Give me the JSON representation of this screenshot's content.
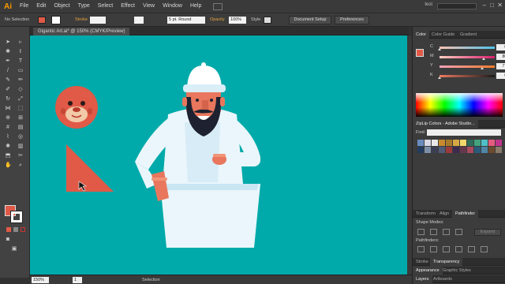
{
  "app": {
    "logo": "Ai"
  },
  "menu": [
    "File",
    "Edit",
    "Object",
    "Type",
    "Select",
    "Effect",
    "View",
    "Window",
    "Help"
  ],
  "workspace": "test",
  "window_controls": {
    "minimize": "–",
    "maximize": "□",
    "close": "✕"
  },
  "control_bar": {
    "selection_label": "No Selection",
    "stroke_label": "Stroke",
    "brush_value": "5 pt. Round",
    "opacity_label": "Opacity",
    "opacity_value": "100%",
    "style_label": "Style",
    "document_setup": "Document Setup",
    "preferences": "Preferences"
  },
  "document": {
    "tab_title": "Gigantic Art.ai* @ 150% (CMYK/Preview)"
  },
  "colors": {
    "fill": "#e05a47",
    "artboard": "#00aaaa",
    "skin": "#e8775d",
    "robe": "#eaf6fb",
    "robe_shadow": "#c9e6f3",
    "beard": "#1e2230",
    "triangle": "#e05a47",
    "circle": "#e05a47"
  },
  "status_bar": {
    "zoom": "150%",
    "page": "1",
    "tool": "Selection"
  },
  "panels": {
    "color": {
      "tabs": [
        "Color",
        "Color Guide",
        "Gradient"
      ],
      "sliders": [
        {
          "label": "C",
          "value": "0",
          "percent": 0,
          "gradient": "linear-gradient(to right,#f9c1b0,#4fc3e8)"
        },
        {
          "label": "M",
          "value": "80",
          "percent": 80,
          "gradient": "linear-gradient(to right,#ffd0c0,#d81f6e)"
        },
        {
          "label": "Y",
          "value": "77",
          "percent": 77,
          "gradient": "linear-gradient(to right,#f1a0b8,#f07a2a)"
        },
        {
          "label": "K",
          "value": "0",
          "percent": 0,
          "gradient": "linear-gradient(to right,#f07a60,#1a1a1a)"
        }
      ]
    },
    "ziplip": {
      "title": "ZipLip Colors - Adobe Studio...",
      "find_label": "Find:",
      "swatches": [
        "#6b8bbf",
        "#d7d7e6",
        "#e8e8e8",
        "#c98a2e",
        "#a87a2b",
        "#d6a845",
        "#f0d86b",
        "#2e6e5b",
        "#42a37e",
        "#4fc0c9",
        "#e35c7d",
        "#c0338c",
        "#233b5e",
        "#7e8fa8",
        "#3c3f52",
        "#515a76",
        "#9c3a3a",
        "#3d2b4f",
        "#64374b",
        "#a84a5e",
        "#2a5b7a",
        "#4f86a6",
        "#6c4a2e",
        "#8a7a6a"
      ]
    },
    "pathfinder": {
      "tabs": [
        "Transform",
        "Align",
        "Pathfinder"
      ],
      "shape_modes": "Shape Modes:",
      "pathfinders": "Pathfinders:",
      "expand": "Expand"
    },
    "transparency": {
      "tabs": [
        "Stroke",
        "Transparency"
      ]
    },
    "appearance": {
      "tabs": [
        "Appearance",
        "Graphic Styles"
      ]
    },
    "layers": {
      "tabs": [
        "Layers",
        "Artboards"
      ]
    }
  }
}
